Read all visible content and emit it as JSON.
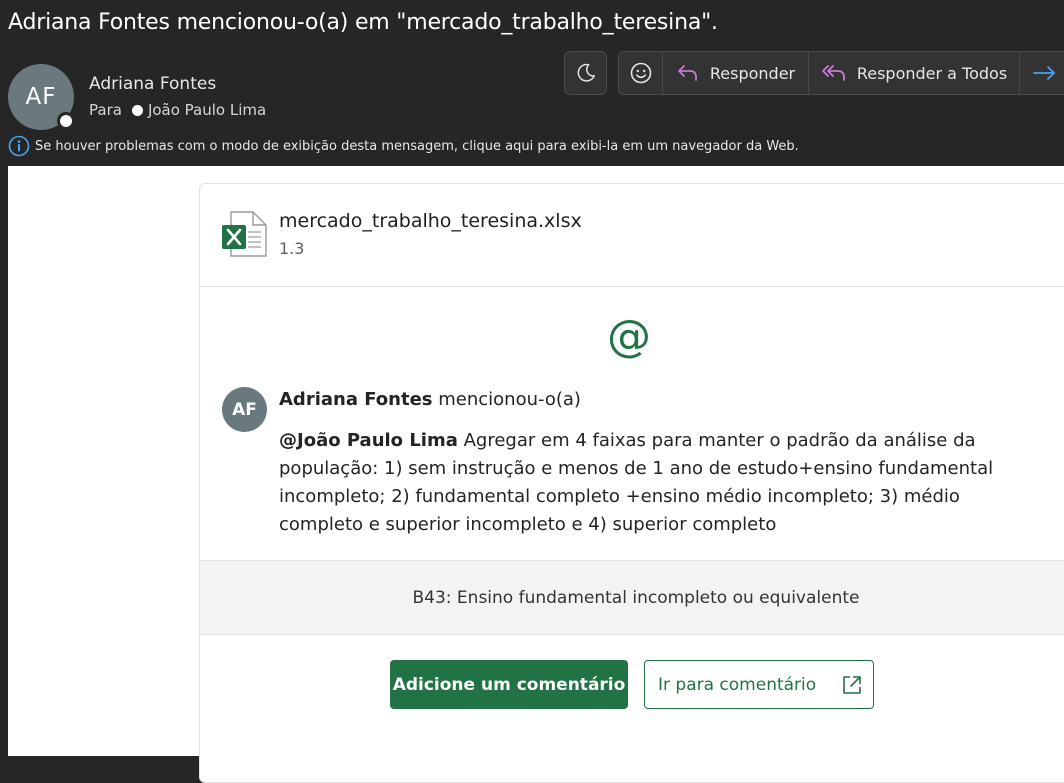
{
  "header": {
    "subject": "Adriana Fontes mencionou-o(a) em \"mercado_trabalho_teresina\".",
    "sender_initials": "AF",
    "sender_name": "Adriana Fontes",
    "to_label": "Para",
    "recipient": "João Paulo Lima",
    "info_text": "Se houver problemas com o modo de exibição desta mensagem, clique aqui para exibi-la em um navegador da Web."
  },
  "toolbar": {
    "reply_label": "Responder",
    "reply_all_label": "Responder a Todos",
    "icons": [
      "moon-icon",
      "emoji-icon",
      "reply-icon",
      "reply-all-icon",
      "forward-icon"
    ]
  },
  "card": {
    "file_name": "mercado_trabalho_teresina.xlsx",
    "file_version": "1.3",
    "at_symbol": "@",
    "comment_initials": "AF",
    "comment_author": "Adriana Fontes",
    "comment_action": "mencionou-o(a)",
    "mention": "@João Paulo Lima",
    "comment_body": "Agregar em 4 faixas para manter o padrão da análise da população: 1) sem instrução e menos de 1 ano de estudo+ensino fundamental incompleto; 2) fundamental completo +ensino médio incompleto; 3) médio completo e superior incompleto e 4) superior completo",
    "cell_reference": "B43: Ensino fundamental incompleto ou equivalente",
    "add_comment_label": "Adicione um comentário",
    "go_to_comment_label": "Ir para comentário"
  },
  "colors": {
    "excel_green": "#217346",
    "avatar_gray": "#69797e",
    "reply_purple": "#c879d6",
    "info_blue": "#4aa3f0"
  }
}
